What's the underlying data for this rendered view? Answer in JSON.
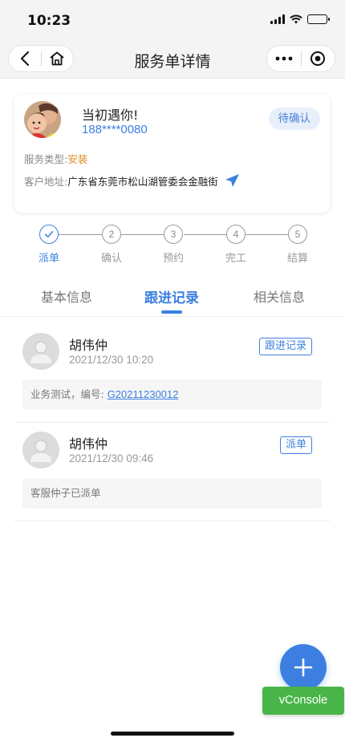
{
  "status_bar": {
    "time": "10:23"
  },
  "nav": {
    "title": "服务单详情"
  },
  "customer": {
    "name": "当初遇你!",
    "phone": "188****0080",
    "status": "待确认",
    "service_type_label": "服务类型:",
    "service_type_value": "安装",
    "address_label": "客户地址:",
    "address_value": "广东省东莞市松山湖管委会金融街"
  },
  "steps": [
    {
      "num": "",
      "label": "派单",
      "done": true
    },
    {
      "num": "2",
      "label": "确认",
      "done": false
    },
    {
      "num": "3",
      "label": "预约",
      "done": false
    },
    {
      "num": "4",
      "label": "完工",
      "done": false
    },
    {
      "num": "5",
      "label": "结算",
      "done": false
    }
  ],
  "tabs": [
    {
      "label": "基本信息",
      "active": false
    },
    {
      "label": "跟进记录",
      "active": true
    },
    {
      "label": "相关信息",
      "active": false
    }
  ],
  "records": [
    {
      "name": "胡伟仲",
      "time": "2021/12/30 10:20",
      "tag": "跟进记录",
      "content_prefix": "业务测试，编号: ",
      "content_link": "G20211230012"
    },
    {
      "name": "胡伟仲",
      "time": "2021/12/30 09:46",
      "tag": "派单",
      "content_prefix": "客服仲子已派单",
      "content_link": ""
    }
  ],
  "fab": {
    "icon": "plus-icon"
  },
  "vconsole": {
    "label": "vConsole"
  },
  "colors": {
    "accent": "#3d7fe0",
    "service_type": "#e08a1e",
    "vconsole": "#49b549"
  }
}
